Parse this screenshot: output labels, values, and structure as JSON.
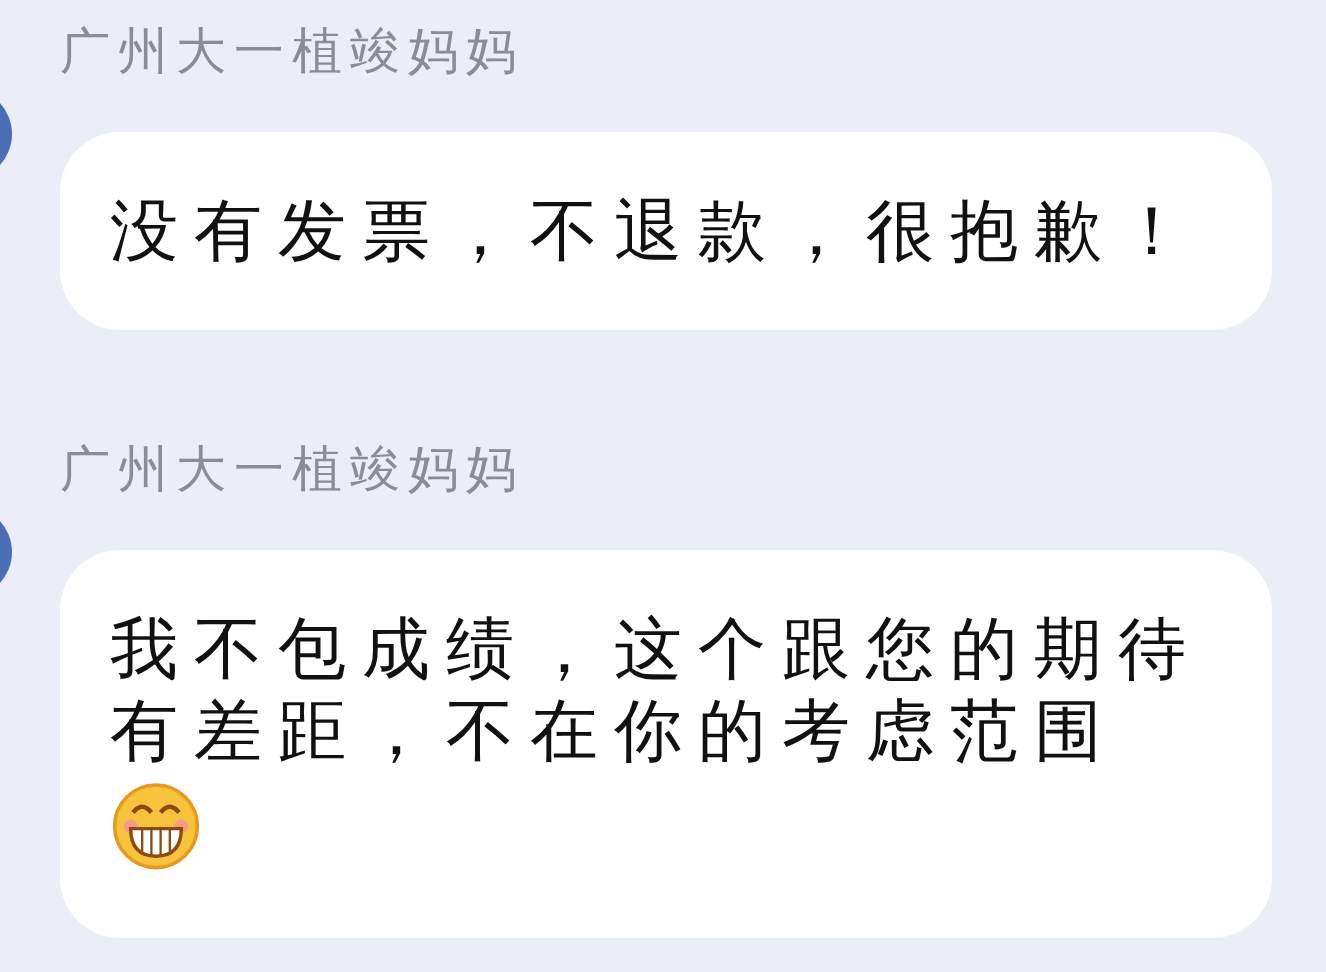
{
  "messages": [
    {
      "sender": "广州大一植竣妈妈",
      "text": "没有发票，不退款，很抱歉！",
      "emoji": false
    },
    {
      "sender": "广州大一植竣妈妈",
      "text": "我不包成绩，这个跟您的期待有差距，不在你的考虑范围",
      "emoji": true
    }
  ]
}
